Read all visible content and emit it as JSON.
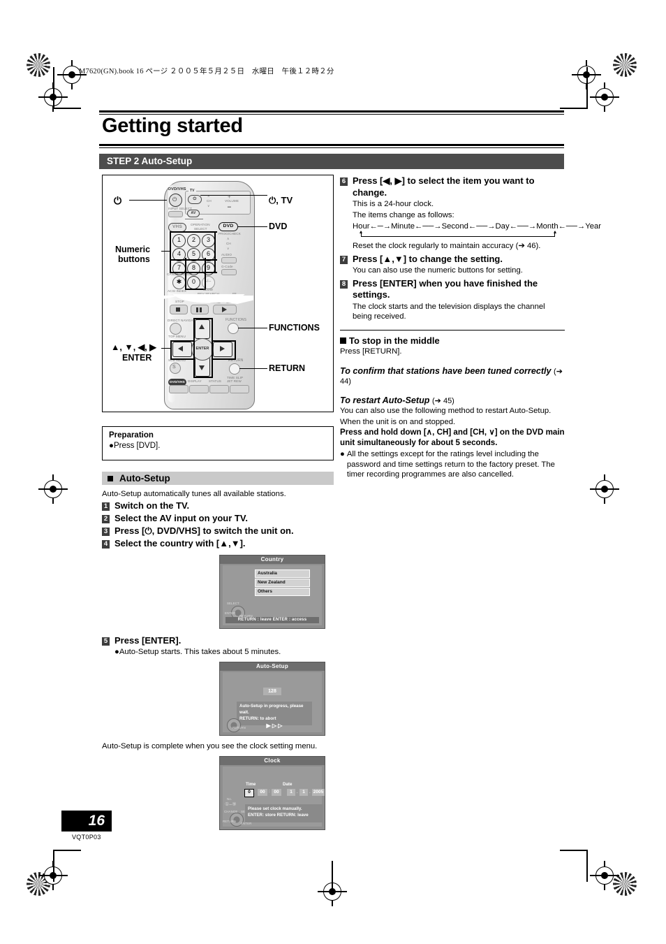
{
  "slug": "M7620(GN).book  16 ページ  ２００５年５月２５日　水曜日　午後１２時２分",
  "title": "Getting started",
  "step_bar": "STEP 2  Auto-Setup",
  "remote_callouts": {
    "power": "⏻",
    "power_tv": "⏻, TV",
    "dvd": "DVD",
    "numeric": "Numeric\nbuttons",
    "numeric_l1": "Numeric",
    "numeric_l2": "buttons",
    "functions": "FUNCTIONS",
    "arrows": "▲, ▼, ◀, ▶",
    "enter": "ENTER",
    "return": "RETURN"
  },
  "remote_faces": {
    "dvd_vhs": "DVD/VHS",
    "tv": "TV",
    "input_select": "INPUT SELECT",
    "av": "AV",
    "ch": "CH",
    "volume": "VOLUME",
    "vhs": "VHS",
    "operation": "OPERATION",
    "select": "SELECT",
    "dvd": "DVD",
    "prog_check": "PROG/CHECK",
    "audio": "AUDIO",
    "gcode": "G-Code",
    "cancel_reset": "CANCEL/RESET",
    "acsi_index": "ACSI INDEX",
    "slow": "SLOW",
    "rev_search": "REV SEARCH",
    "ff": "FF",
    "stop": "STOP",
    "direct_navigator": "DIRECT NAVIGATOR",
    "top_menu": "TOP MENU",
    "sub_menu": "SUB MENU",
    "functions": "FUNCTIONS",
    "return": "RETURN",
    "enter": "ENTER",
    "time_slip": "TIME SLIP",
    "display": "DISPLAY",
    "status": "STATUS",
    "jet_rew": "JET REW",
    "keys": [
      "1",
      "2",
      "3",
      "4",
      "5",
      "6",
      "7",
      "8",
      "9",
      "0"
    ],
    "star": "✱",
    "dash": "-/--"
  },
  "preparation": {
    "heading": "Preparation",
    "item": "Press [DVD]."
  },
  "auto_setup_section": {
    "heading": "Auto-Setup",
    "intro": "Auto-Setup automatically tunes all available stations.",
    "steps": [
      {
        "n": "1",
        "text": "Switch on the TV."
      },
      {
        "n": "2",
        "text": "Select the AV input on your TV."
      },
      {
        "n": "3",
        "text": "Press [⏻, DVD/VHS] to switch the unit on."
      },
      {
        "n": "4",
        "text": "Select the country with [▲,▼]."
      },
      {
        "n": "5",
        "text": "Press [ENTER]."
      }
    ],
    "step5_sub": "Auto-Setup starts. This takes about 5 minutes.",
    "complete_caption": "Auto-Setup is complete when you see the clock setting menu."
  },
  "osd_country": {
    "title": "Country",
    "items": [
      "Australia",
      "New Zealand",
      "Others"
    ],
    "select_label": "SELECT",
    "enter_label": "ENTER",
    "return_label": "RETURN",
    "footer": "RETURN : leave   ENTER : access"
  },
  "osd_autosetup": {
    "title": "Auto-Setup",
    "channel": "128",
    "message_line1": "Auto-Setup in progress, please wait.",
    "message_line2": "RETURN:  to abort",
    "progress": "▶ ▷ ▷",
    "return_label": "RETURN"
  },
  "osd_clock": {
    "title": "Clock",
    "time_label": "Time",
    "date_label": "Date",
    "hour": "0",
    "minute": "00",
    "second": "00",
    "day": "1",
    "month": "1",
    "year": "2005",
    "no_label": "No.",
    "message_line1": "Please set clock manually.",
    "message_line2": "ENTER: store    RETURN: leave",
    "change_label": "CHANGE",
    "select_label": "SELECT",
    "return_label": "RETURN",
    "enter_label": "ENTER"
  },
  "right_column": {
    "step6": {
      "n": "6",
      "heading": "Press [◀, ▶] to select the item you want to change.",
      "line1": "This is a 24-hour clock.",
      "line2": "The items change as follows:",
      "flow": [
        "Hour",
        "Minute",
        "Second",
        "Day",
        "Month",
        "Year"
      ],
      "flow_text": "Hour←─→Minute←──→Second←──→Day←──→Month←──→Year",
      "line3": "Reset the clock regularly to maintain accuracy (➔ 46)."
    },
    "step7": {
      "n": "7",
      "heading": "Press [▲,▼] to change the setting.",
      "line1": "You can also use the numeric buttons for setting."
    },
    "step8": {
      "n": "8",
      "heading": "Press [ENTER] when you have finished the settings.",
      "line1": "The clock starts and the television displays the channel being received."
    },
    "stop_middle": {
      "heading": "To stop in the middle",
      "line1": "Press [RETURN]."
    },
    "confirm": {
      "heading": "To confirm that stations have been tuned correctly",
      "page": "(➔ 44)"
    },
    "restart": {
      "heading": "To restart Auto-Setup",
      "page": "(➔ 45)",
      "line1": "You can also use the following method to restart Auto-Setup.",
      "line2": "When the unit is on and stopped.",
      "bold1": "Press and hold down [∧, CH] and [CH, ∨] on the DVD main unit simultaneously for about 5 seconds.",
      "bullet": "All the settings except for the ratings level including the password and time settings return to the factory preset. The timer recording programmes are also cancelled."
    }
  },
  "footer": {
    "page_number": "16",
    "code": "VQT0P03"
  },
  "colors": {
    "step_bar_bg": "#4d4d4d",
    "section_bar_bg": "#c9c9c9",
    "osd_bg": "#8e8e8e",
    "num_badge": "#3d3d3d"
  }
}
